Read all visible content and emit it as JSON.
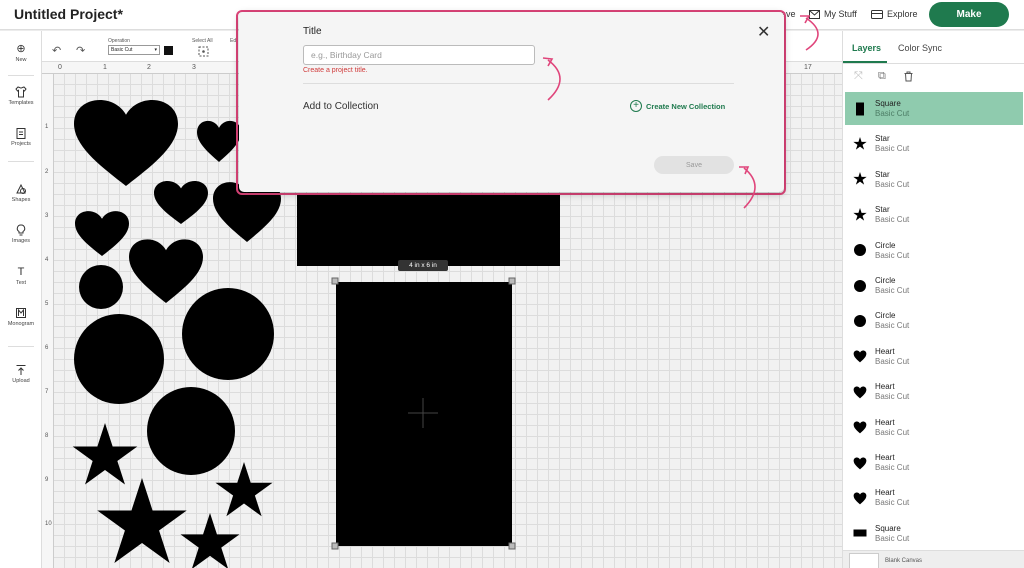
{
  "header": {
    "project_title": "Untitled Project*",
    "save_label": "Save",
    "mystuff_label": "My Stuff",
    "explore_label": "Explore",
    "make_label": "Make"
  },
  "rail": {
    "items": [
      {
        "label": "New",
        "icon": "plus-circle-icon"
      },
      {
        "label": "Templates",
        "icon": "shirt-icon"
      },
      {
        "label": "Projects",
        "icon": "clipboard-icon"
      },
      {
        "label": "Shapes",
        "icon": "shapes-icon"
      },
      {
        "label": "Images",
        "icon": "lightbulb-icon"
      },
      {
        "label": "Text",
        "icon": "text-icon"
      },
      {
        "label": "Monogram",
        "icon": "monogram-icon"
      },
      {
        "label": "Upload",
        "icon": "upload-icon"
      }
    ]
  },
  "toolbar": {
    "operation_label": "Operation",
    "operation_value": "Basic Cut",
    "select_all_label": "Select All",
    "edit_label": "Ed"
  },
  "rulers": {
    "top": [
      "0",
      "1",
      "2",
      "3",
      "17"
    ],
    "left": [
      "1",
      "2",
      "3",
      "4",
      "5",
      "6",
      "7",
      "8",
      "9",
      "10"
    ]
  },
  "canvas": {
    "size_tag": "4 in x 6 in"
  },
  "layers_panel": {
    "tabs": [
      "Layers",
      "Color Sync"
    ],
    "items": [
      {
        "name": "Square",
        "sub": "Basic Cut",
        "icon": "square",
        "selected": true
      },
      {
        "name": "Star",
        "sub": "Basic Cut",
        "icon": "star"
      },
      {
        "name": "Star",
        "sub": "Basic Cut",
        "icon": "star"
      },
      {
        "name": "Star",
        "sub": "Basic Cut",
        "icon": "star"
      },
      {
        "name": "Circle",
        "sub": "Basic Cut",
        "icon": "circle"
      },
      {
        "name": "Circle",
        "sub": "Basic Cut",
        "icon": "circle"
      },
      {
        "name": "Circle",
        "sub": "Basic Cut",
        "icon": "circle"
      },
      {
        "name": "Heart",
        "sub": "Basic Cut",
        "icon": "heart"
      },
      {
        "name": "Heart",
        "sub": "Basic Cut",
        "icon": "heart"
      },
      {
        "name": "Heart",
        "sub": "Basic Cut",
        "icon": "heart"
      },
      {
        "name": "Heart",
        "sub": "Basic Cut",
        "icon": "heart"
      },
      {
        "name": "Heart",
        "sub": "Basic Cut",
        "icon": "heart"
      },
      {
        "name": "Square",
        "sub": "Basic Cut",
        "icon": "rect"
      }
    ],
    "blank_canvas_label": "Blank Canvas"
  },
  "modal": {
    "title_label": "Title",
    "title_placeholder": "e.g., Birthday Card",
    "title_value": "",
    "error_text": "Create a project title.",
    "collection_label": "Add to Collection",
    "new_collection_label": "Create New Collection",
    "save_label": "Save",
    "close_icon": "close-icon"
  },
  "colors": {
    "accent_green": "#1f7a4e",
    "highlight_pink": "#e0457b",
    "error_red": "#d03a3a",
    "selected_layer": "#8fcbae"
  }
}
